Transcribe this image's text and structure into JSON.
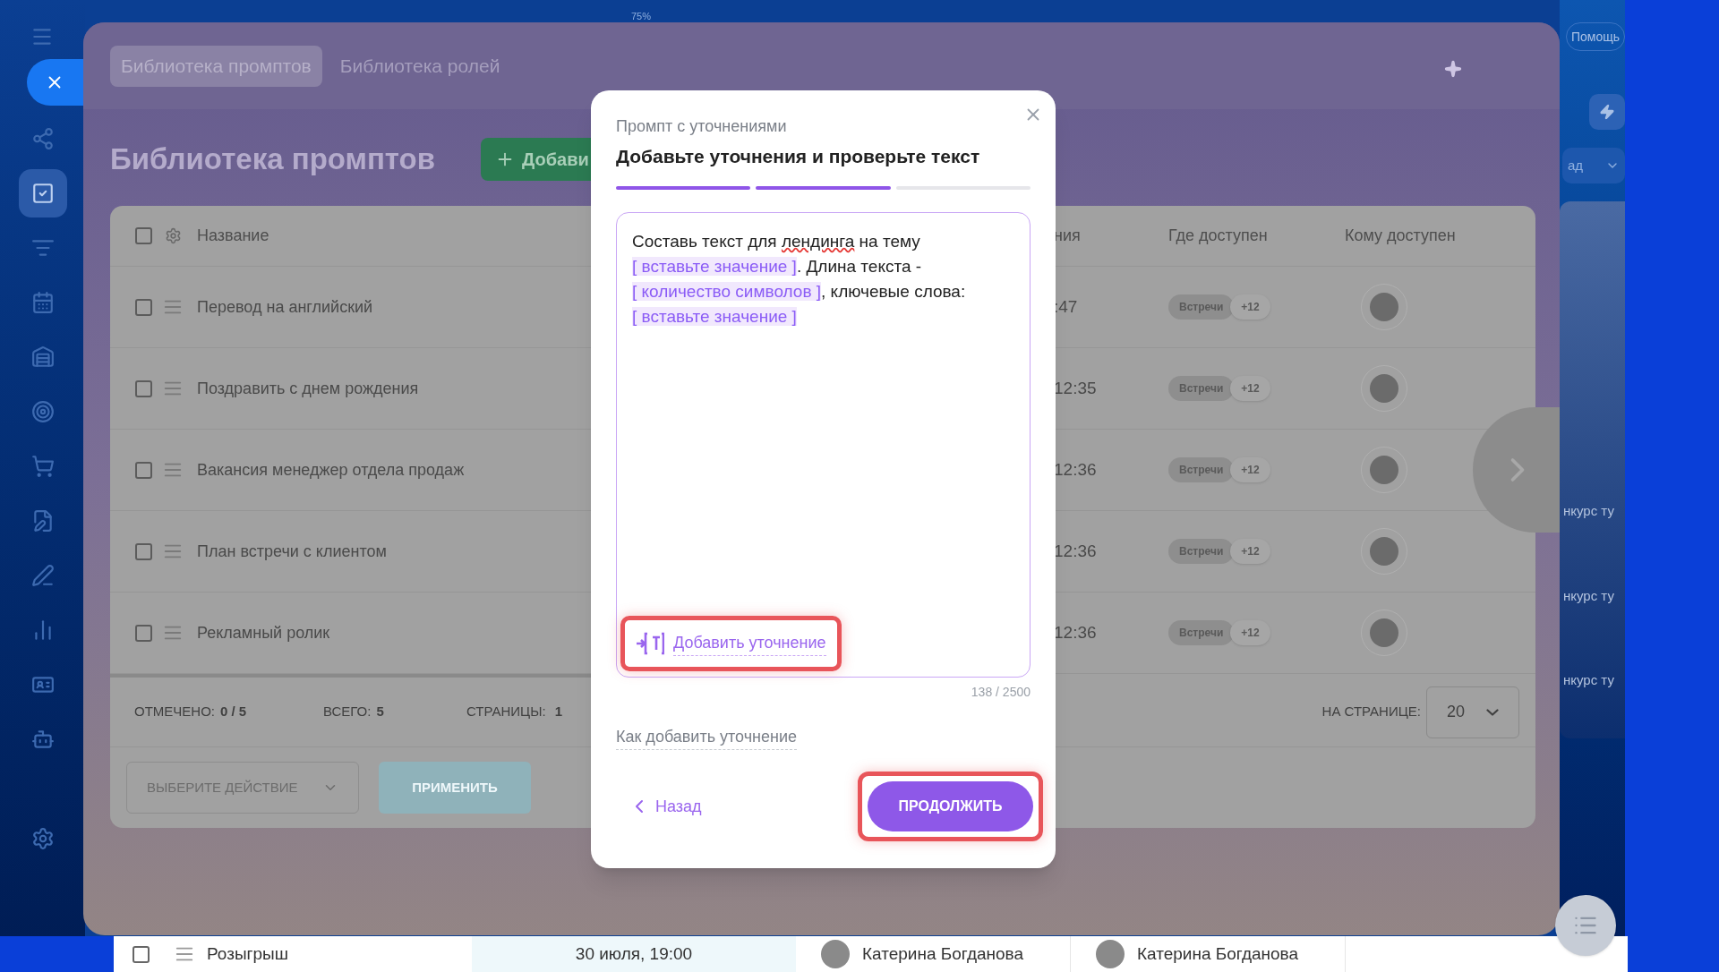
{
  "background_app": {
    "zoom_label": "75%",
    "help_button": "Помощь",
    "dropdown_partial": "ад",
    "list_partial": [
      "нкурс ту",
      "нкурс ту",
      "нкурс ту"
    ],
    "bottom_row": {
      "checked": false,
      "name": "Розыгрыш",
      "date": "30 июля, 19:00",
      "people": [
        "Катерина Богданова",
        "Катерина Богданова"
      ]
    }
  },
  "sidebar": {
    "items": [
      {
        "kind": "nodes",
        "selected": false
      },
      {
        "kind": "tasks",
        "selected": true
      },
      {
        "kind": "funnel",
        "selected": false
      },
      {
        "kind": "calendar",
        "selected": false
      },
      {
        "kind": "warehouse",
        "selected": false
      },
      {
        "kind": "target",
        "selected": false
      },
      {
        "kind": "cart",
        "selected": false
      },
      {
        "kind": "document",
        "selected": false
      },
      {
        "kind": "pen",
        "selected": false
      },
      {
        "kind": "chart",
        "selected": false
      },
      {
        "kind": "contact",
        "selected": false
      },
      {
        "kind": "robot",
        "selected": false
      },
      {
        "kind": "settings",
        "selected": false
      }
    ]
  },
  "library": {
    "tabs": [
      {
        "label": "Библиотека промптов",
        "selected": true
      },
      {
        "label": "Библиотека ролей",
        "selected": false
      }
    ],
    "title": "Библиотека промптов",
    "add_button": "Добави",
    "table": {
      "select_all_checked": false,
      "columns": [
        "Название",
        "ния",
        "Где доступен",
        "Кому доступен"
      ],
      "rows": [
        {
          "checked": false,
          "name": "Перевод на английский",
          "column_2": ":47",
          "where": "Встречи",
          "more": "+12"
        },
        {
          "checked": false,
          "name": "Поздравить с днем рождения",
          "column_2": "12:35",
          "where": "Встречи",
          "more": "+12"
        },
        {
          "checked": false,
          "name": "Вакансия менеджер отдела продаж",
          "column_2": "12:36",
          "where": "Встречи",
          "more": "+12"
        },
        {
          "checked": false,
          "name": "План встречи с клиентом",
          "column_2": "12:36",
          "where": "Встречи",
          "more": "+12"
        },
        {
          "checked": false,
          "name": "Рекламный ролик",
          "column_2": "12:36",
          "where": "Встречи",
          "more": "+12"
        }
      ]
    },
    "footer": {
      "marked_label": "ОТМЕЧЕНО:",
      "marked_value": "0 / 5",
      "total_label": "ВСЕГО:",
      "total_value": "5",
      "pages_label": "СТРАНИЦЫ:",
      "pages_value": "1",
      "per_page_label": "НА СТРАНИЦЕ:",
      "per_page_value": "20"
    },
    "action_select": "ВЫБЕРИТЕ ДЕЙСТВИЕ",
    "apply_button": {
      "label": "ПРИМЕНИТЬ",
      "disabled": true
    }
  },
  "dialog": {
    "subtitle": "Промпт с уточнениями",
    "title": "Добавьте уточнения и проверьте текст",
    "steps": [
      {
        "completed": true
      },
      {
        "completed": true
      },
      {
        "completed": false
      }
    ],
    "editor": [
      {
        "kind": "text",
        "text": "Составь текст для "
      },
      {
        "kind": "misspelled",
        "text": "лендинга"
      },
      {
        "kind": "text",
        "text": " на тему "
      },
      {
        "kind": "placeholder",
        "text": "[ вставьте значение ]"
      },
      {
        "kind": "text",
        "text": ". Длина текста - "
      },
      {
        "kind": "placeholder",
        "text": "[ количество символов ]"
      },
      {
        "kind": "text",
        "text": ", ключевые слова: "
      },
      {
        "kind": "placeholder",
        "text": "[ вставьте значение ]"
      }
    ],
    "add_clarification": {
      "label": "Добавить уточнение",
      "highlighted": true
    },
    "counter": "138 / 2500",
    "help_link": "Как добавить уточнение",
    "back_button": "Назад",
    "continue_button": {
      "label": "ПРОДОЛЖИТЬ",
      "highlighted": true
    }
  }
}
